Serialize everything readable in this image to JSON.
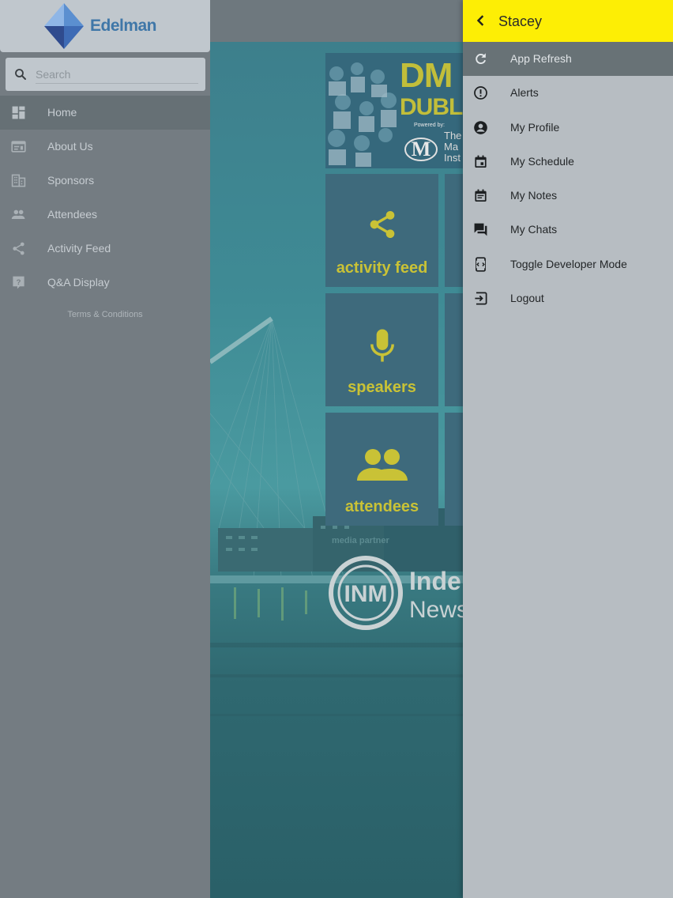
{
  "sidebar": {
    "logo_text": "Edelman",
    "search_placeholder": "Search",
    "items": [
      {
        "label": "Home",
        "icon": "dashboard-icon",
        "active": true
      },
      {
        "label": "About Us",
        "icon": "info-card-icon"
      },
      {
        "label": "Sponsors",
        "icon": "building-icon"
      },
      {
        "label": "Attendees",
        "icon": "people-icon"
      },
      {
        "label": "Activity Feed",
        "icon": "share-icon"
      },
      {
        "label": "Q&A Display",
        "icon": "question-icon"
      }
    ],
    "terms": "Terms & Conditions"
  },
  "main": {
    "banner": {
      "title": "DM",
      "subtitle": "DUBL",
      "powered_by": "Powered by:",
      "org_line1": "The",
      "org_line2": "Ma",
      "org_line3": "Inst"
    },
    "tiles": [
      {
        "label": "activity feed",
        "icon": "share-icon"
      },
      {
        "label": "speakers",
        "icon": "microphone-icon"
      },
      {
        "label": "attendees",
        "icon": "people-icon"
      }
    ],
    "media_partner": "media partner",
    "partner_logo_initials": "INM",
    "partner_name_line1": "Inde",
    "partner_name_line2": "News"
  },
  "menu": {
    "user_name": "Stacey",
    "items": [
      {
        "label": "App Refresh",
        "icon": "refresh-icon",
        "active": true
      },
      {
        "label": "Alerts",
        "icon": "alert-icon"
      },
      {
        "label": "My Profile",
        "icon": "account-circle-icon"
      },
      {
        "label": "My Schedule",
        "icon": "calendar-icon"
      },
      {
        "label": "My Notes",
        "icon": "notes-icon"
      },
      {
        "label": "My Chats",
        "icon": "chat-icon"
      },
      {
        "label": "Toggle Developer Mode",
        "icon": "developer-mode-icon"
      },
      {
        "label": "Logout",
        "icon": "logout-icon"
      }
    ]
  },
  "colors": {
    "accent_yellow": "#fdee05",
    "tile_text": "#c9c236",
    "brand_blue": "#3f77a8"
  }
}
